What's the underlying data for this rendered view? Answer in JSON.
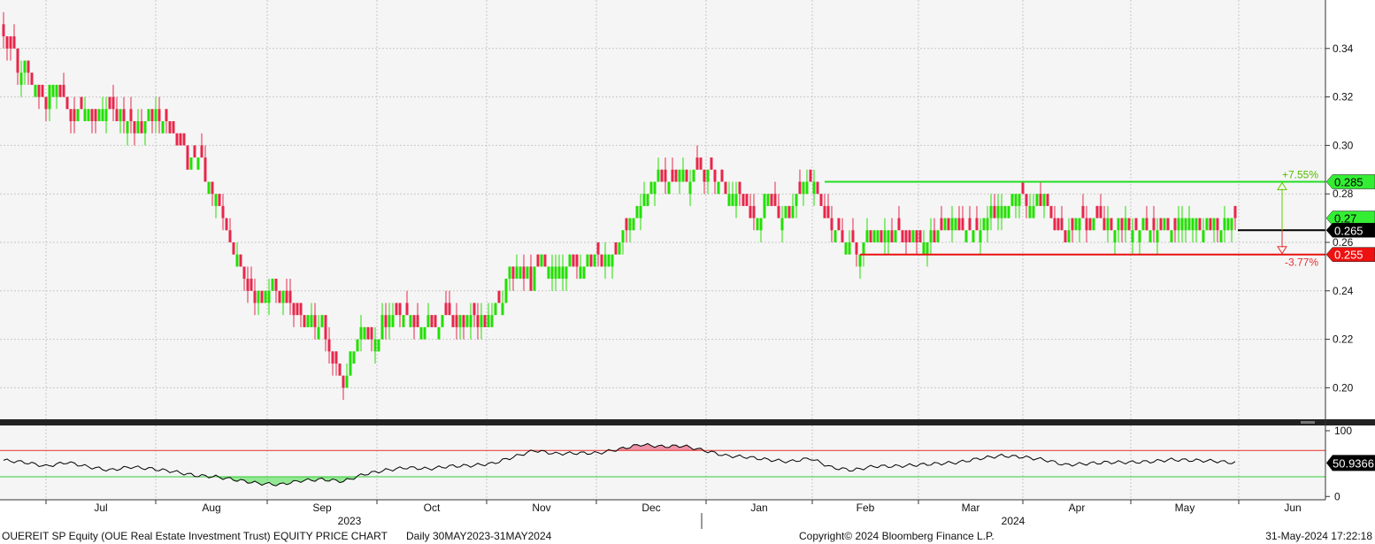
{
  "chart_data": {
    "type": "candlestick",
    "title": "OUEREIT SP Equity (OUE Real Estate Investment Trust) EQUITY PRICE CHART",
    "period": "Daily 30MAY2023-31MAY2024",
    "copyright": "Copyright© 2024 Bloomberg Finance L.P.",
    "timestamp": "31-May-2024 17:22:18",
    "colors": {
      "up": "#22e000",
      "down": "#e8264a",
      "background": "#f5f5f5",
      "resistance": "#22dd22",
      "support": "#e81010"
    },
    "price_axis": {
      "ylim": [
        0.187,
        0.36
      ],
      "ticks": [
        "0.20",
        "0.22",
        "0.24",
        "0.26",
        "0.28",
        "0.30",
        "0.32",
        "0.34"
      ],
      "grid": true
    },
    "x_axis": {
      "months": [
        "Jul",
        "Aug",
        "Sep",
        "Oct",
        "Nov",
        "Dec",
        "Jan",
        "Feb",
        "Mar",
        "Apr",
        "May",
        "Jun"
      ],
      "years": [
        "2023",
        "2024"
      ]
    },
    "price_path": [
      [
        0,
        0.345
      ],
      [
        4,
        0.334
      ],
      [
        8,
        0.326
      ],
      [
        12,
        0.32
      ],
      [
        15,
        0.325
      ],
      [
        18,
        0.315
      ],
      [
        20,
        0.31
      ],
      [
        23,
        0.315
      ],
      [
        27,
        0.312
      ],
      [
        31,
        0.315
      ],
      [
        35,
        0.31
      ],
      [
        39,
        0.308
      ],
      [
        42,
        0.312
      ],
      [
        44,
        0.31
      ],
      [
        47,
        0.304
      ],
      [
        51,
        0.296
      ],
      [
        55,
        0.292
      ],
      [
        58,
        0.286
      ],
      [
        61,
        0.272
      ],
      [
        64,
        0.262
      ],
      [
        67,
        0.252
      ],
      [
        70,
        0.238
      ],
      [
        73,
        0.236
      ],
      [
        76,
        0.244
      ],
      [
        79,
        0.236
      ],
      [
        82,
        0.232
      ],
      [
        86,
        0.228
      ],
      [
        90,
        0.226
      ],
      [
        93,
        0.212
      ],
      [
        96,
        0.205
      ],
      [
        99,
        0.215
      ],
      [
        102,
        0.225
      ],
      [
        105,
        0.22
      ],
      [
        108,
        0.23
      ],
      [
        111,
        0.232
      ],
      [
        114,
        0.229
      ],
      [
        118,
        0.227
      ],
      [
        122,
        0.228
      ],
      [
        126,
        0.229
      ],
      [
        130,
        0.226
      ],
      [
        134,
        0.227
      ],
      [
        137,
        0.23
      ],
      [
        140,
        0.236
      ],
      [
        143,
        0.248
      ],
      [
        146,
        0.252
      ],
      [
        149,
        0.244
      ],
      [
        152,
        0.254
      ],
      [
        156,
        0.25
      ],
      [
        160,
        0.252
      ],
      [
        164,
        0.25
      ],
      [
        168,
        0.252
      ],
      [
        172,
        0.257
      ],
      [
        176,
        0.268
      ],
      [
        180,
        0.278
      ],
      [
        184,
        0.287
      ],
      [
        188,
        0.285
      ],
      [
        192,
        0.287
      ],
      [
        196,
        0.288
      ],
      [
        200,
        0.287
      ],
      [
        204,
        0.284
      ],
      [
        207,
        0.28
      ],
      [
        210,
        0.275
      ],
      [
        213,
        0.27
      ],
      [
        216,
        0.278
      ],
      [
        219,
        0.27
      ],
      [
        222,
        0.275
      ],
      [
        225,
        0.28
      ],
      [
        228,
        0.285
      ],
      [
        231,
        0.275
      ],
      [
        234,
        0.265
      ],
      [
        237,
        0.26
      ],
      [
        240,
        0.256
      ],
      [
        244,
        0.262
      ],
      [
        248,
        0.262
      ],
      [
        252,
        0.262
      ],
      [
        256,
        0.26
      ],
      [
        260,
        0.262
      ],
      [
        264,
        0.265
      ],
      [
        268,
        0.27
      ],
      [
        271,
        0.263
      ],
      [
        275,
        0.265
      ],
      [
        279,
        0.272
      ],
      [
        283,
        0.277
      ],
      [
        287,
        0.278
      ],
      [
        291,
        0.277
      ],
      [
        294,
        0.278
      ],
      [
        297,
        0.267
      ],
      [
        300,
        0.262
      ],
      [
        304,
        0.267
      ],
      [
        308,
        0.268
      ],
      [
        312,
        0.267
      ],
      [
        316,
        0.266
      ],
      [
        320,
        0.268
      ],
      [
        324,
        0.27
      ],
      [
        328,
        0.268
      ],
      [
        332,
        0.267
      ],
      [
        336,
        0.27
      ],
      [
        339,
        0.266
      ],
      [
        342,
        0.268
      ],
      [
        345,
        0.27
      ],
      [
        348,
        0.267
      ]
    ],
    "annotations": {
      "resistance": {
        "price": 0.285,
        "label": "0.285",
        "pct": "+7.55%"
      },
      "support": {
        "price": 0.255,
        "label": "0.255",
        "pct": "-3.77%"
      },
      "last_price": {
        "price": 0.265,
        "label": "0.265"
      },
      "prev_tag": {
        "price": 0.27,
        "label": "0.27"
      }
    },
    "indicator": {
      "type": "RSI",
      "ylim": [
        -5,
        108
      ],
      "ticks": [
        "0",
        "100"
      ],
      "upper_band": 70,
      "lower_band": 30,
      "last_value": "50.9366",
      "path": [
        [
          0,
          55
        ],
        [
          6,
          52
        ],
        [
          12,
          46
        ],
        [
          18,
          52
        ],
        [
          24,
          45
        ],
        [
          30,
          40
        ],
        [
          36,
          45
        ],
        [
          42,
          42
        ],
        [
          48,
          38
        ],
        [
          54,
          32
        ],
        [
          60,
          30
        ],
        [
          66,
          25
        ],
        [
          72,
          20
        ],
        [
          78,
          18
        ],
        [
          84,
          24
        ],
        [
          90,
          26
        ],
        [
          96,
          23
        ],
        [
          102,
          34
        ],
        [
          108,
          40
        ],
        [
          114,
          44
        ],
        [
          120,
          42
        ],
        [
          126,
          46
        ],
        [
          132,
          47
        ],
        [
          138,
          50
        ],
        [
          144,
          60
        ],
        [
          150,
          70
        ],
        [
          156,
          65
        ],
        [
          162,
          66
        ],
        [
          168,
          66
        ],
        [
          174,
          72
        ],
        [
          180,
          79
        ],
        [
          186,
          76
        ],
        [
          192,
          77
        ],
        [
          198,
          70
        ],
        [
          204,
          62
        ],
        [
          210,
          60
        ],
        [
          216,
          56
        ],
        [
          222,
          53
        ],
        [
          228,
          58
        ],
        [
          234,
          44
        ],
        [
          240,
          40
        ],
        [
          246,
          46
        ],
        [
          252,
          46
        ],
        [
          258,
          48
        ],
        [
          264,
          50
        ],
        [
          270,
          52
        ],
        [
          276,
          58
        ],
        [
          282,
          62
        ],
        [
          288,
          60
        ],
        [
          294,
          56
        ],
        [
          300,
          48
        ],
        [
          306,
          50
        ],
        [
          312,
          52
        ],
        [
          318,
          52
        ],
        [
          324,
          53
        ],
        [
          330,
          56
        ],
        [
          336,
          55
        ],
        [
          342,
          54
        ],
        [
          348,
          51
        ]
      ]
    }
  }
}
